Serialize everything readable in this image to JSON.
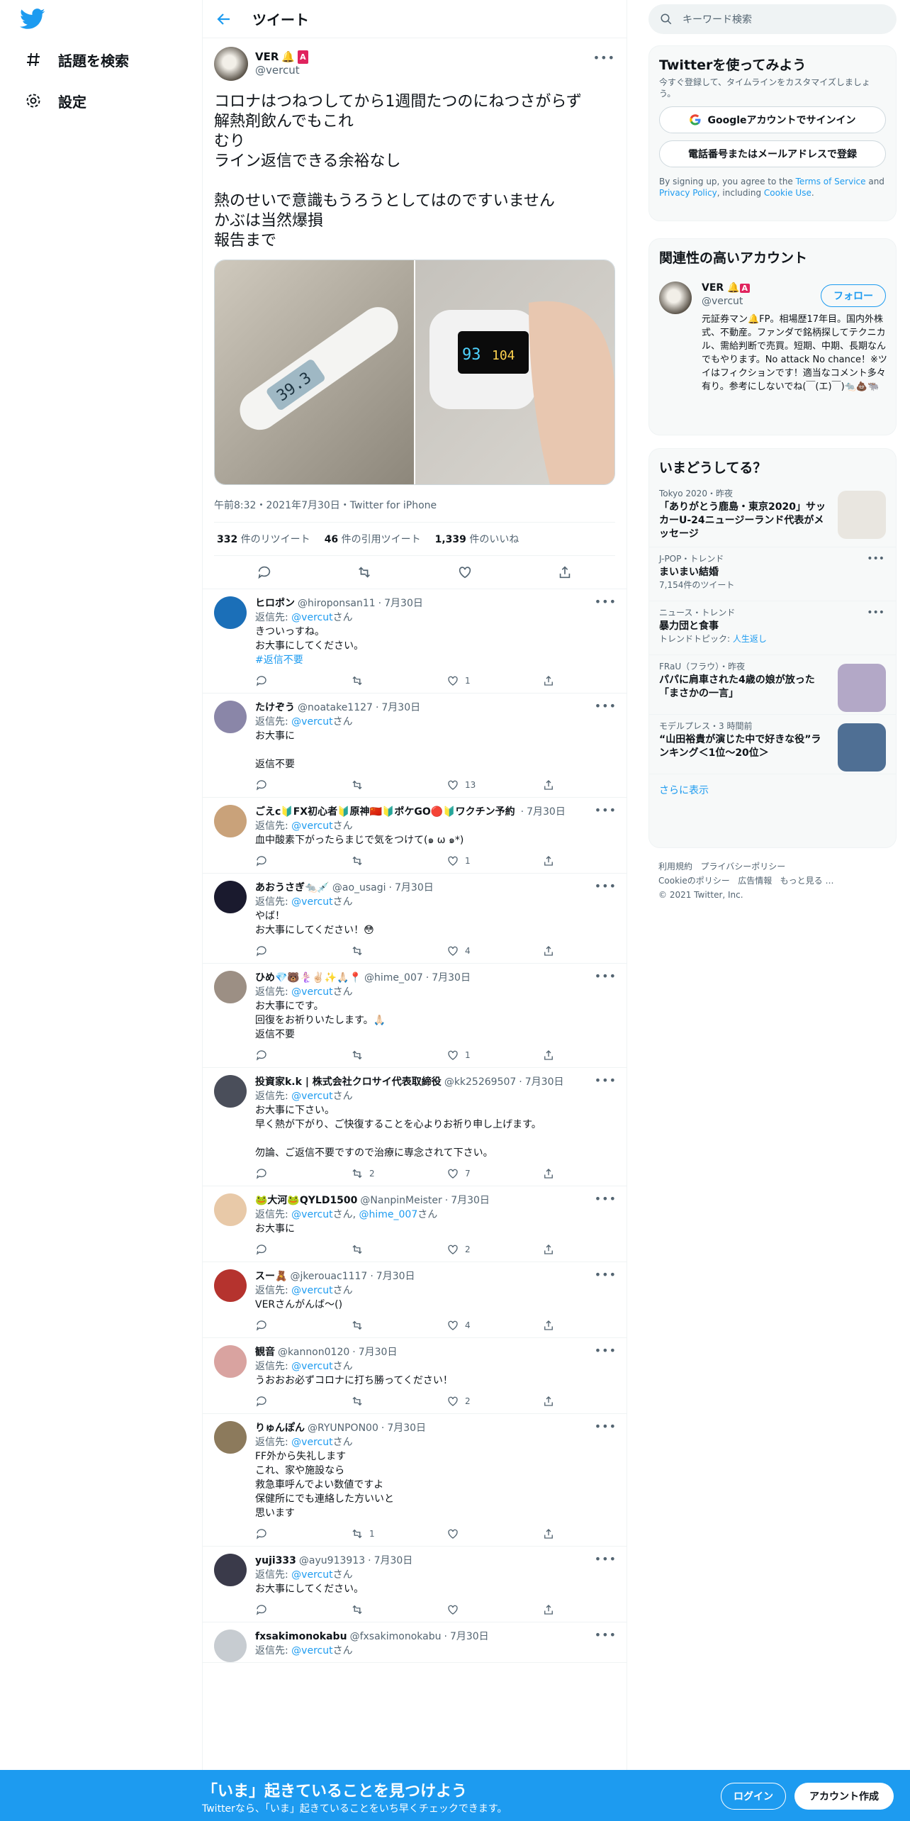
{
  "nav": {
    "explore": "話題を検索",
    "settings": "設定"
  },
  "header": {
    "title": "ツイート"
  },
  "tweet": {
    "name": "VER",
    "handle": "@vercut",
    "text": "コロナはつねつしてから1週間たつのにねつさがらず\n解熱剤飲んでもこれ\nむり\nライン返信できる余裕なし\n\n熱のせいで意識もうろうとしてはのですいません\nかぶは当然爆損\n報告まで",
    "meta": "午前8:32・2021年7月30日・Twitter for iPhone",
    "retweets_n": "332",
    "retweets_l": "件のリツイート",
    "quotes_n": "46",
    "quotes_l": "件の引用ツイート",
    "likes_n": "1,339",
    "likes_l": "件のいいね",
    "thermometer": "39.3",
    "oximeter_spo2": "93",
    "oximeter_pr": "104"
  },
  "reply_to_label": "返信先:",
  "san": "さん",
  "replies": [
    {
      "name": "ヒロポン",
      "handle": "@hiroponsan11",
      "date": "7月30日",
      "to": "@vercut",
      "text": "きついっすね。\nお大事にしてください。",
      "tag": "#返信不要",
      "rt": "",
      "like": "1",
      "color": "#1b6fb8"
    },
    {
      "name": "たけぞう",
      "handle": "@noatake1127",
      "date": "7月30日",
      "to": "@vercut",
      "text": "お大事に\n\n返信不要",
      "tag": "",
      "rt": "",
      "like": "13",
      "color": "#8a86a8"
    },
    {
      "name": "ごえc🔰FX初心者🔰原神🇨🇳🔰ポケGO🔴🔰ワクチン予約",
      "handle": "",
      "date": "7月30日",
      "to": "@vercut",
      "text": "血中酸素下がったらまじで気をつけて(๑ ω ๑*)",
      "tag": "",
      "rt": "",
      "like": "1",
      "color": "#c9a27a"
    },
    {
      "name": "あおうさぎ🐀💉",
      "handle": "@ao_usagi",
      "date": "7月30日",
      "to": "@vercut",
      "text": "やば！\nお大事にしてください！😳",
      "tag": "",
      "rt": "",
      "like": "4",
      "color": "#1a1a2e"
    },
    {
      "name": "ひめ💎🐻🧜🏻‍♀️✌🏻✨🙏🏻📍",
      "handle": "@hime_007",
      "date": "7月30日",
      "to": "@vercut",
      "text": "お大事にです。\n回復をお祈りいたします。🙏🏻\n返信不要",
      "tag": "",
      "rt": "",
      "like": "1",
      "color": "#9c8f84"
    },
    {
      "name": "投資家k.k | 株式会社クロサイ代表取締役",
      "handle": "@kk25269507",
      "date": "7月30日",
      "to": "@vercut",
      "text": "お大事に下さい。\n早く熱が下がり、ご快復することを心よりお祈り申し上げます。\n\n勿論、ご返信不要ですので治療に専念されて下さい。",
      "tag": "",
      "rt": "2",
      "like": "7",
      "color": "#4a4e5a"
    },
    {
      "name": "🐸大河🐸QYLD1500",
      "handle": "@NanpinMeister",
      "date": "7月30日",
      "to": "@vercut",
      "to2": "@hime_007",
      "text": "お大事に",
      "tag": "",
      "rt": "",
      "like": "2",
      "color": "#e8c9a8"
    },
    {
      "name": "スー🧸",
      "handle": "@jkerouac1117",
      "date": "7月30日",
      "to": "@vercut",
      "text": "VERさんがんば〜()",
      "tag": "",
      "rt": "",
      "like": "4",
      "color": "#b5332e"
    },
    {
      "name": "観音",
      "handle": "@kannon0120",
      "date": "7月30日",
      "to": "@vercut",
      "text": "うおおお必ずコロナに打ち勝ってください！",
      "tag": "",
      "rt": "",
      "like": "2",
      "color": "#d9a3a0"
    },
    {
      "name": "りゅんぽん",
      "handle": "@RYUNPON00",
      "date": "7月30日",
      "to": "@vercut",
      "text": "FF外から失礼します\nこれ、家や施設なら\n救急車呼んでよい数値ですよ\n保健所にでも連絡した方いいと\n思います",
      "tag": "",
      "rt": "1",
      "like": "",
      "color": "#8c7a5c"
    },
    {
      "name": "yuji333",
      "handle": "@ayu913913",
      "date": "7月30日",
      "to": "@vercut",
      "text": "お大事にしてください。",
      "tag": "",
      "rt": "",
      "like": "",
      "color": "#3a3a4a"
    },
    {
      "name": "fxsakimonokabu",
      "handle": "@fxsakimonokabu",
      "date": "7月30日",
      "to": "@vercut",
      "text": "",
      "tag": "",
      "rt": "",
      "like": "",
      "color": "#c7ccd1"
    }
  ],
  "side": {
    "search_placeholder": "キーワード検索",
    "signup": {
      "title": "Twitterを使ってみよう",
      "desc": "今すぐ登録して、タイムラインをカスタマイズしましょう。",
      "google": "Googleアカウントでサインイン",
      "phone": "電話番号またはメールアドレスで登録",
      "terms_pre": "By signing up, you agree to the ",
      "terms": "Terms of Service",
      "and": " and ",
      "privacy": "Privacy Policy",
      "including": ", including ",
      "cookie": "Cookie Use",
      "end": "."
    },
    "related": {
      "title": "関連性の高いアカウント",
      "name": "VER",
      "handle": "@vercut",
      "follow": "フォロー",
      "bio": "元証券マン🔔FP。相場歴17年目。国内外株式、不動産。ファンダで銘柄探してテクニカル、需給判断で売買。短期、中期、長期なんでもやります。No attack No chance！※ツイはフィクションです！適当なコメント多々有り。参考にしないでね(￣(エ)￣)🐀💩🐃"
    },
    "trends": {
      "title": "いまどうしてる？",
      "items": [
        {
          "meta": "Tokyo 2020・昨夜",
          "title": "「ありがとう鹿島・東京2020」サッカーU-24ニュージーランド代表がメッセージ",
          "sub": "",
          "thumb": "#e9e6e0"
        },
        {
          "meta": "J-POP・トレンド",
          "title": "まいまい結婚",
          "sub": "7,154件のツイート",
          "thumb": ""
        },
        {
          "meta": "ニュース・トレンド",
          "title": "暴力団と食事",
          "sub": "トレンドトピック: ",
          "sub_link": "人生返し",
          "thumb": ""
        },
        {
          "meta": "FRaU（フラウ）・昨夜",
          "title": "パパに肩車された4歳の娘が放った「まさかの一言」",
          "sub": "",
          "thumb": "#b3a8c7"
        },
        {
          "meta": "モデルプレス・3 時間前",
          "title": "“山田裕貴が演じた中で好きな役”ランキング＜1位～20位＞",
          "sub": "",
          "thumb": "#4f6f94"
        }
      ],
      "more": "さらに表示"
    },
    "footer": {
      "l1a": "利用規約",
      "l1b": "プライバシーポリシー",
      "l2a": "Cookieのポリシー",
      "l2b": "広告情報",
      "l2c": "もっと見る …",
      "copy": "© 2021 Twitter, Inc."
    }
  },
  "bottom": {
    "headline": "「いま」起きていることを見つけよう",
    "sub": "Twitterなら、「いま」起きていることをいち早くチェックできます。",
    "login": "ログイン",
    "signup": "アカウント作成"
  }
}
